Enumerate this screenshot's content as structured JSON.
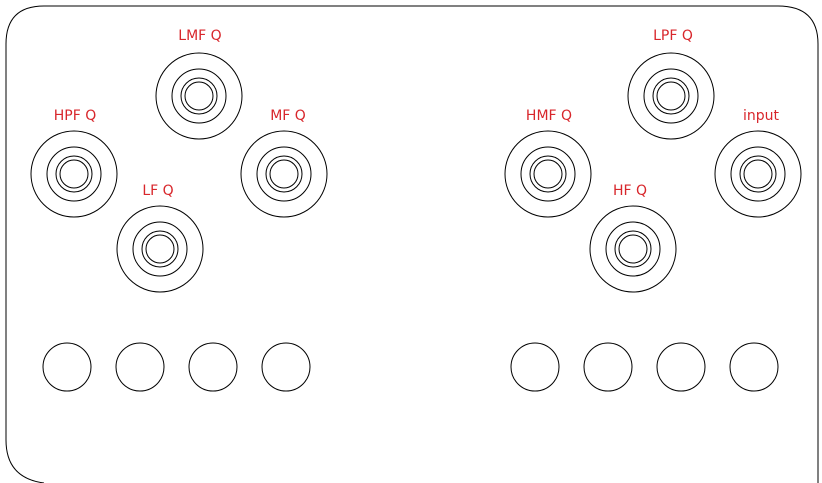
{
  "panel": {
    "label_color": "#d8262b",
    "outline_color": "#000000",
    "background": "#ffffff"
  },
  "knobs": [
    {
      "label": "LMF Q"
    },
    {
      "label": "HPF Q"
    },
    {
      "label": "MF Q"
    },
    {
      "label": "LF Q"
    },
    {
      "label": "LPF Q"
    },
    {
      "label": "HMF Q"
    },
    {
      "label": "input"
    },
    {
      "label": "HF Q"
    }
  ],
  "buttons": [
    {
      "label": ""
    },
    {
      "label": ""
    },
    {
      "label": ""
    },
    {
      "label": ""
    },
    {
      "label": ""
    },
    {
      "label": ""
    },
    {
      "label": ""
    },
    {
      "label": ""
    }
  ]
}
